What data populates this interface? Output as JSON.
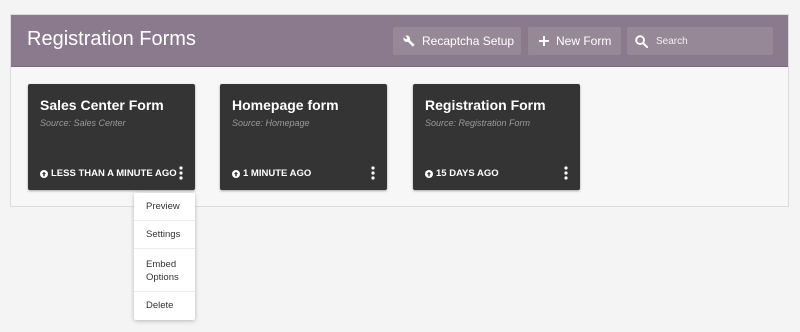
{
  "header": {
    "title": "Registration Forms",
    "recaptcha_label": "Recaptcha Setup",
    "new_form_label": "New Form",
    "search_placeholder": "Search"
  },
  "cards": [
    {
      "title": "Sales Center Form",
      "source": "Source: Sales Center",
      "time": "LESS THAN A MINUTE AGO"
    },
    {
      "title": "Homepage form",
      "source": "Source: Homepage",
      "time": "1 MINUTE AGO"
    },
    {
      "title": "Registration Form",
      "source": "Source: Registration Form",
      "time": "15 DAYS AGO"
    }
  ],
  "menu": {
    "preview": "Preview",
    "settings": "Settings",
    "embed_line1": "Embed",
    "embed_line2": "Options",
    "delete": "Delete"
  },
  "icons": {
    "recaptcha": "wrench-icon",
    "new_form": "plus-icon",
    "search": "search-icon",
    "time": "arrow-up-circle-icon",
    "card_menu": "kebab-icon"
  },
  "colors": {
    "header_bg": "#8b7a8e",
    "card_bg": "#343434"
  }
}
